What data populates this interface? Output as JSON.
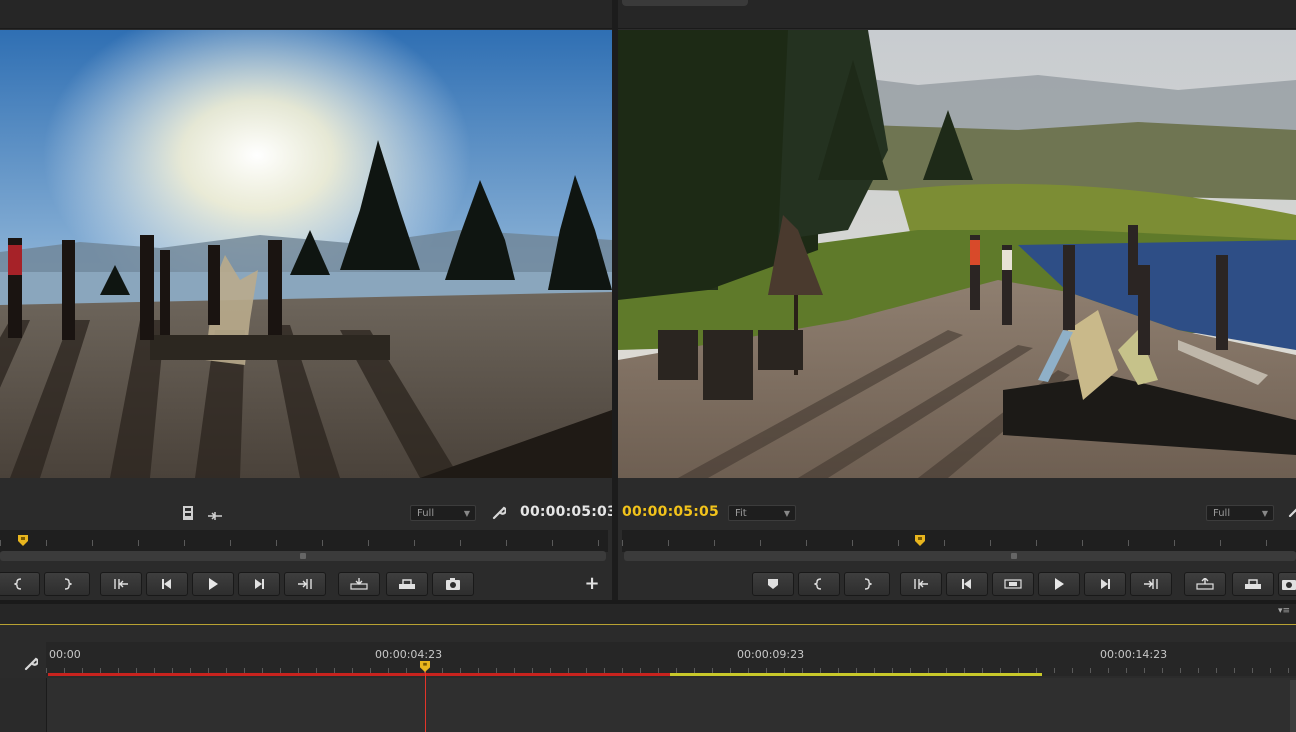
{
  "source_monitor": {
    "resolution_label": "Full",
    "timecode": "00:00:05:03",
    "icons": [
      "film-icon",
      "insert-icon",
      "wrench-icon"
    ],
    "buttons": [
      "mark-in",
      "mark-out",
      "go-to-in",
      "step-back",
      "play",
      "step-forward",
      "go-to-out",
      "insert",
      "overwrite",
      "export-frame",
      "add"
    ],
    "add_label": "+"
  },
  "program_monitor": {
    "timecode": "00:00:05:05",
    "zoom_label": "Fit",
    "resolution_label": "Full",
    "buttons": [
      "add-marker",
      "mark-in",
      "mark-out",
      "go-to-in",
      "step-back",
      "play-in-to-out",
      "play",
      "step-forward",
      "go-to-out",
      "lift",
      "extract",
      "export-frame"
    ]
  },
  "timeline": {
    "tick_labels": [
      "00:00",
      "00:00:04:23",
      "00:00:09:23",
      "00:00:14:23"
    ],
    "menu_label": "▾≡"
  },
  "colors": {
    "timecode_program": "#f2c31b",
    "timecode_source": "#e6e6e6",
    "playhead": "#e3352a",
    "render_red": "#c8231e",
    "render_yellow": "#c8c82a",
    "panel_bg": "#2b2b2b"
  }
}
